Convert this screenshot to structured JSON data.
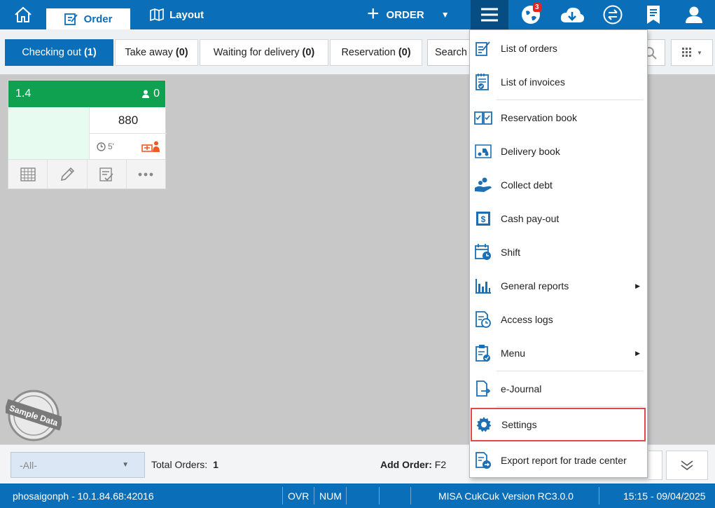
{
  "topbar": {
    "tabs": [
      {
        "label": "Order"
      },
      {
        "label": "Layout"
      }
    ],
    "new_order_label": "ORDER",
    "notification_count": "3"
  },
  "filters": {
    "tabs": [
      {
        "label": "Checking out",
        "count": "(1)"
      },
      {
        "label": "Take away",
        "count": "(0)"
      },
      {
        "label": "Waiting for delivery",
        "count": "(0)"
      },
      {
        "label": "Reservation",
        "count": "(0)"
      }
    ],
    "search_placeholder": "Search"
  },
  "order_card": {
    "table": "1.4",
    "guests": "0",
    "amount": "880",
    "elapsed": "5'"
  },
  "stamp_text": "Sample Data",
  "menu": {
    "items": [
      {
        "label": "List of orders",
        "icon": "edit-list-icon"
      },
      {
        "label": "List of invoices",
        "icon": "invoice-icon"
      },
      {
        "label": "Reservation book",
        "icon": "book-icon"
      },
      {
        "label": "Delivery book",
        "icon": "delivery-icon"
      },
      {
        "label": "Collect debt",
        "icon": "coins-hand-icon"
      },
      {
        "label": "Cash pay-out",
        "icon": "cash-icon"
      },
      {
        "label": "Shift",
        "icon": "calendar-clock-icon"
      },
      {
        "label": "General reports",
        "icon": "bar-chart-icon"
      },
      {
        "label": "Access logs",
        "icon": "log-clock-icon"
      },
      {
        "label": "Menu",
        "icon": "clipboard-check-icon"
      },
      {
        "label": "e-Journal",
        "icon": "journal-export-icon"
      },
      {
        "label": "Settings",
        "icon": "gear-icon"
      },
      {
        "label": "Export report for trade center",
        "icon": "report-export-icon"
      }
    ]
  },
  "footer": {
    "filter_value": "-All-",
    "total_label": "Total Orders:",
    "total_value": "1",
    "add_order_label": "Add Order:",
    "add_order_key": "F2"
  },
  "status": {
    "server": "phosaigonph - 10.1.84.68:42016",
    "ovr": "OVR",
    "num": "NUM",
    "version": "MISA CukCuk Version RC3.0.0",
    "datetime": "15:15 - 09/04/2025"
  },
  "colors": {
    "primary": "#0a6fb8",
    "card_header": "#0fa14f",
    "highlight": "#e2474b"
  }
}
